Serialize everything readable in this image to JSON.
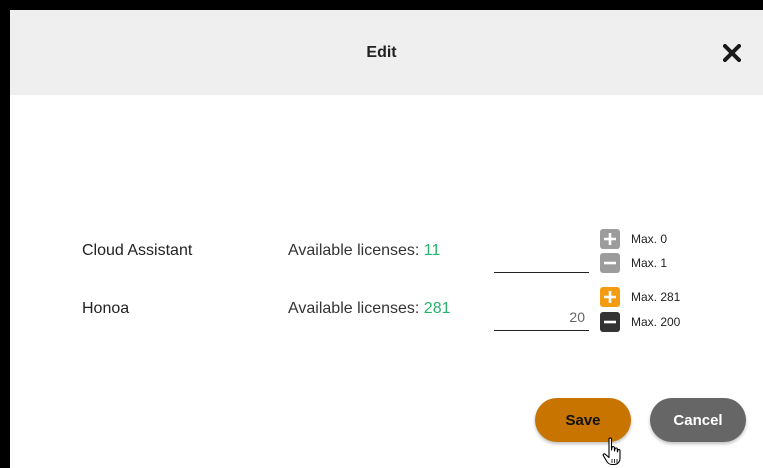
{
  "dialog": {
    "title": "Edit",
    "close_icon": "close-icon"
  },
  "licenses": [
    {
      "name": "Cloud Assistant",
      "available_label": "Available licenses:",
      "available_count": "11",
      "value": "",
      "plus_enabled": false,
      "minus_enabled": false,
      "max_plus": "Max. 0",
      "max_minus": "Max. 1"
    },
    {
      "name": "Honoa",
      "available_label": "Available licenses:",
      "available_count": "281",
      "value": "20",
      "plus_enabled": true,
      "minus_enabled": true,
      "max_plus": "Max. 281",
      "max_minus": "Max. 200"
    }
  ],
  "actions": {
    "save_label": "Save",
    "cancel_label": "Cancel"
  },
  "colors": {
    "header_bg": "#efefef",
    "available_count": "#27b36b",
    "plus_active": "#f39c12",
    "minus_active": "#333333",
    "stepper_disabled": "#9c9c9c",
    "save_bg": "#c77400",
    "cancel_bg": "#666666"
  },
  "icons": {
    "plus": "plus-icon",
    "minus": "minus-icon",
    "cursor": "hand-pointer-icon"
  }
}
